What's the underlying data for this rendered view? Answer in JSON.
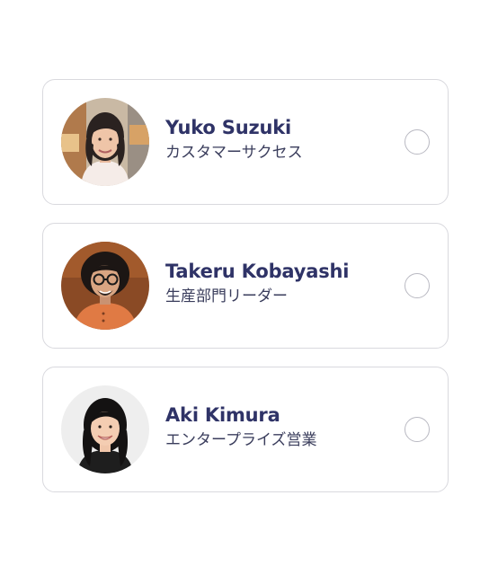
{
  "options": [
    {
      "name": "Yuko Suzuki",
      "role": "カスタマーサクセス",
      "avatar_icon": "person-photo-woman-short-hair",
      "selected": false
    },
    {
      "name": "Takeru Kobayashi",
      "role": "生産部門リーダー",
      "avatar_icon": "person-photo-man-glasses",
      "selected": false
    },
    {
      "name": "Aki Kimura",
      "role": "エンタープライズ営業",
      "avatar_icon": "person-photo-woman-long-hair",
      "selected": false
    }
  ],
  "colors": {
    "name_text": "#2f3367",
    "role_text": "#3a3d5c",
    "card_border": "#d9d9de",
    "radio_border": "#b9b9c2"
  }
}
